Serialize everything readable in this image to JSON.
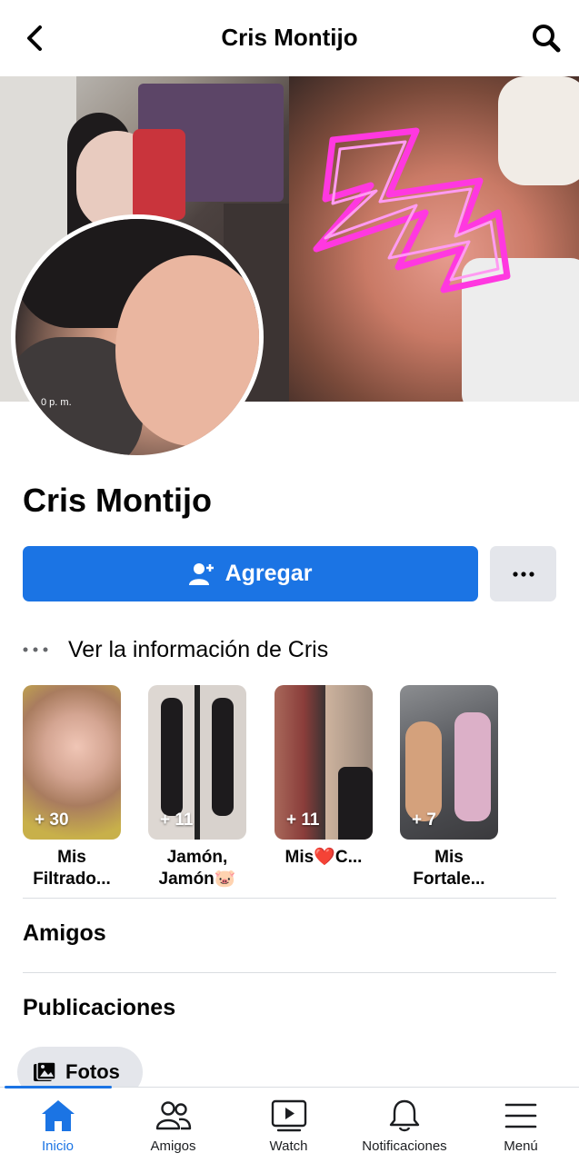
{
  "header": {
    "title": "Cris Montijo"
  },
  "cover": {
    "timestamp_text": "0 p. m."
  },
  "profile": {
    "name": "Cris Montijo"
  },
  "actions": {
    "add_label": "Agregar",
    "add_icon": "add-friend-icon",
    "more_icon": "more-dots-icon"
  },
  "info_row": {
    "label": "Ver la información de Cris"
  },
  "featured": [
    {
      "count": "+ 30",
      "label_line1": "Mis",
      "label_line2": "Filtrado..."
    },
    {
      "count": "+ 11",
      "label_line1": "Jamón,",
      "label_line2": "Jamón🐷"
    },
    {
      "count": "+ 11",
      "label_line1": "Mis❤️C...",
      "label_line2": ""
    },
    {
      "count": "+ 7",
      "label_line1": "Mis",
      "label_line2": "Fortale..."
    }
  ],
  "sections": {
    "friends": "Amigos",
    "posts": "Publicaciones"
  },
  "chip": {
    "label": "Fotos"
  },
  "nav": [
    {
      "label": "Inicio",
      "icon": "home-icon",
      "active": true
    },
    {
      "label": "Amigos",
      "icon": "friends-icon"
    },
    {
      "label": "Watch",
      "icon": "watch-icon"
    },
    {
      "label": "Notificaciones",
      "icon": "bell-icon"
    },
    {
      "label": "Menú",
      "icon": "menu-icon"
    }
  ],
  "colors": {
    "accent": "#1b74e4",
    "button_gray": "#e4e6eb",
    "text": "#050505",
    "divider": "#dadde1"
  }
}
